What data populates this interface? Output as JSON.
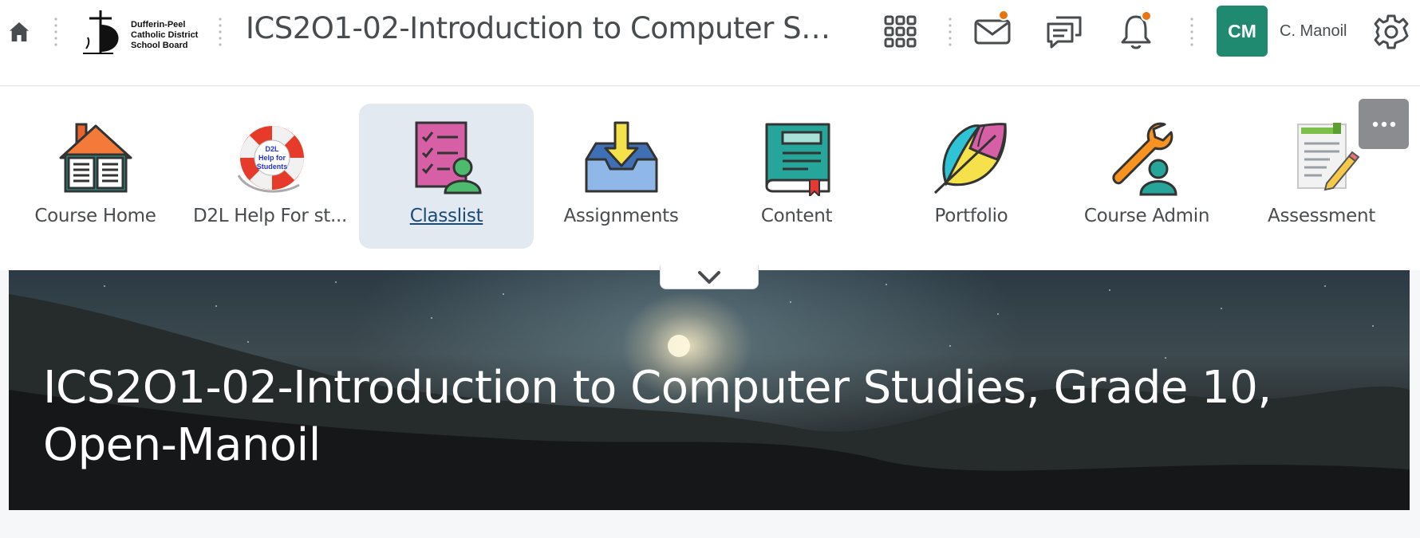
{
  "header": {
    "home_icon": "home-icon",
    "org_logo_lines": [
      "Dufferin-Peel",
      "Catholic District",
      "School Board"
    ],
    "course_title": "ICS2O1-02-Introduction to Computer Stu...",
    "waffle_icon": "course-selector-icon",
    "mail_icon": "mail-icon",
    "chat_icon": "chat-icon",
    "bell_icon": "bell-icon",
    "notification_color": "#e87511",
    "avatar_initials": "CM",
    "avatar_color": "#1f8a70",
    "user_name": "C. Manoil",
    "settings_icon": "gear-icon"
  },
  "nav": {
    "items": [
      {
        "label": "Course Home",
        "icon": "course-home-icon"
      },
      {
        "label": "D2L Help For st...",
        "icon": "help-lifebuoy-icon",
        "icon_text": "D2L Help for Students"
      },
      {
        "label": "Classlist",
        "icon": "classlist-icon",
        "active": true
      },
      {
        "label": "Assignments",
        "icon": "assignments-icon"
      },
      {
        "label": "Content",
        "icon": "content-book-icon"
      },
      {
        "label": "Portfolio",
        "icon": "portfolio-leaf-icon"
      },
      {
        "label": "Course Admin",
        "icon": "course-admin-icon"
      },
      {
        "label": "Assessment",
        "icon": "assessment-icon"
      }
    ],
    "more_icon": "more-options-icon",
    "collapse_icon": "chevron-down-icon"
  },
  "banner": {
    "title": "ICS2O1-02-Introduction to Computer Studies, Grade 10, Open-Manoil"
  }
}
